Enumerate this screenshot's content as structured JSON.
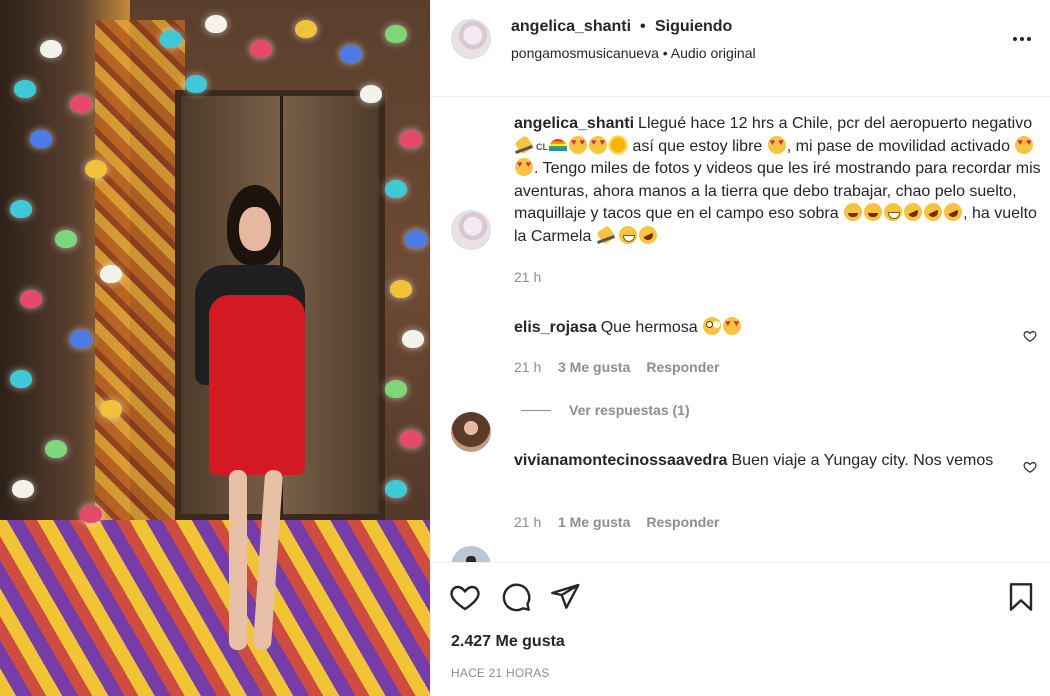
{
  "header": {
    "username": "angelica_shanti",
    "separator": "•",
    "follow_status": "Siguiendo",
    "audio_line": "pongamosmusicanueva • Audio original"
  },
  "caption": {
    "username": "angelica_shanti",
    "part1": "Llegué hace 12 hrs a Chile, pcr del aeropuerto negativo",
    "flag_text": "CL",
    "part2": " así que estoy libre",
    "part3": ", mi pase de movilidad activado",
    "part4": ". Tengo miles de fotos y videos que les iré mostrando para recordar mis aventuras, ahora manos a la tierra que debo trabajar, chao pelo suelto, maquillaje y tacos que en el campo eso sobra",
    "part5": ", ha vuelto la Carmela",
    "time": "21 h"
  },
  "comments": [
    {
      "username": "elis_rojasa",
      "text": "Que hermosa",
      "time": "21 h",
      "likes": "3 Me gusta",
      "reply": "Responder",
      "view_replies": "Ver respuestas (1)"
    },
    {
      "username": "vivianamontecinossaavedra",
      "text": "Buen viaje a Yungay city. Nos vemos",
      "time": "21 h",
      "likes": "1 Me gusta",
      "reply": "Responder"
    }
  ],
  "footer": {
    "likes_count": "2.427 Me gusta",
    "posted": "HACE 21 HORAS"
  },
  "icons": {
    "like": "heart-icon",
    "comment": "comment-icon",
    "share": "paper-plane-icon",
    "save": "bookmark-icon",
    "more": "more-options-icon",
    "comment_like": "heart-icon"
  },
  "colors": {
    "text": "#262626",
    "muted": "#8e8e8e",
    "border": "#efefef",
    "dress": "#d31a22"
  }
}
